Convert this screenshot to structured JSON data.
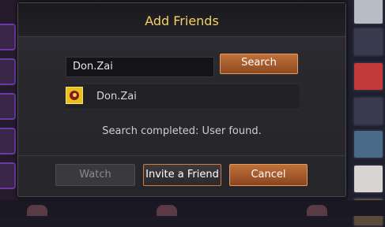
{
  "dialog": {
    "title": "Add Friends",
    "search_value": "Don.Zai",
    "search_button": "Search",
    "result": {
      "name": "Don.Zai",
      "avatar_icon": "guild-emblem-icon"
    },
    "status_text": "Search completed: User found.",
    "buttons": {
      "watch": "Watch",
      "invite": "Invite a Friend",
      "cancel": "Cancel"
    }
  },
  "colors": {
    "title": "#f4d262",
    "accent_orange": "#c0713a",
    "disabled_text": "#8c8b8f"
  }
}
